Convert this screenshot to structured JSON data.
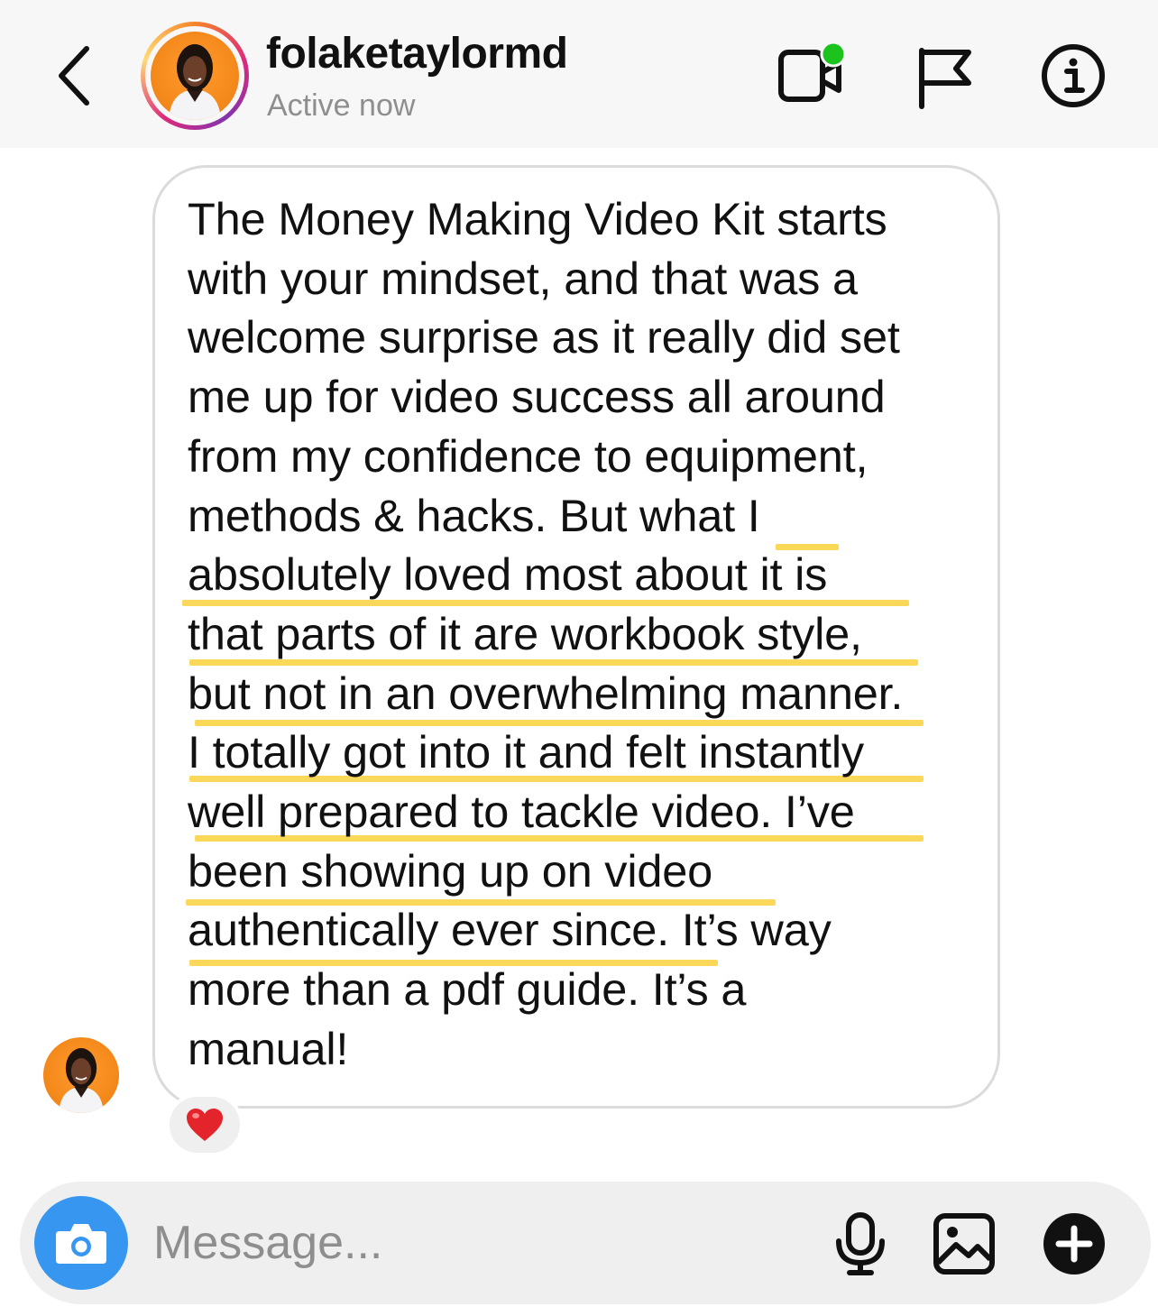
{
  "header": {
    "username": "folaketaylormd",
    "status": "Active now"
  },
  "message": {
    "lines": [
      "The Money Making Video Kit starts",
      "with your mindset, and that was a",
      "welcome surprise as it really did set",
      "me up for video success all around",
      "from my confidence to equipment,",
      "methods & hacks. But what I",
      "absolutely loved most about it is",
      "that parts of it are workbook style,",
      "but not in an overwhelming manner.",
      "I totally got into it and felt instantly",
      "well prepared to tackle video. I’ve",
      "been showing up on video",
      "authentically ever since. It’s way",
      "more than a pdf guide. It’s a",
      "manual!"
    ],
    "reaction": "❤️"
  },
  "composer": {
    "placeholder": "Message..."
  },
  "colors": {
    "accent": "#3797f0",
    "online": "#1dc31d",
    "highlight": "#fcd85a",
    "heart": "#e3242b"
  }
}
